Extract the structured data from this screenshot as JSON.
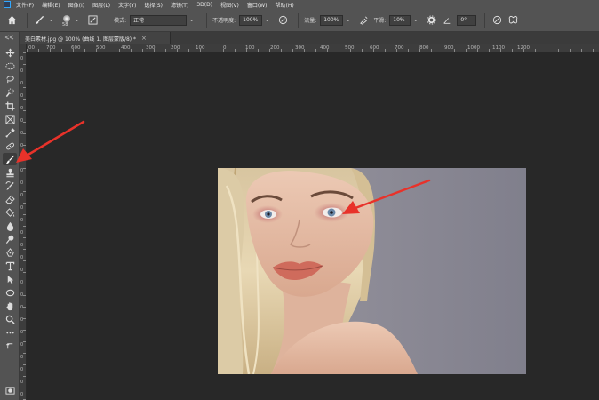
{
  "menubar": {
    "items": [
      "文件(F)",
      "编辑(E)",
      "图像(I)",
      "图层(L)",
      "文字(Y)",
      "选择(S)",
      "滤镜(T)",
      "3D(D)",
      "视图(V)",
      "窗口(W)",
      "帮助(H)"
    ]
  },
  "options": {
    "brush_size": "58",
    "mode_label": "模式:",
    "mode_value": "正常",
    "opacity_label": "不透明度:",
    "opacity_value": "100%",
    "flow_label": "流量:",
    "flow_value": "100%",
    "smoothing_label": "平滑:",
    "smoothing_value": "10%",
    "angle_value": "0°"
  },
  "document": {
    "tab_title": "美白素材.jpg @ 100% (曲线 1, 图层蒙版/8) *",
    "close_glyph": "×"
  },
  "ruler": {
    "h_labels": [
      "00",
      "700",
      "600",
      "500",
      "400",
      "300",
      "200",
      "100",
      "0",
      "100",
      "200",
      "300",
      "400",
      "500",
      "600",
      "700",
      "800",
      "900",
      "1000",
      "1100",
      "1200"
    ],
    "v_labels": [
      "0",
      "0",
      "0",
      "0",
      "0",
      "0",
      "0",
      "0",
      "0",
      "0",
      "0",
      "0",
      "0",
      "0",
      "0",
      "0",
      "0",
      "0",
      "0",
      "0",
      "0",
      "0",
      "0",
      "0",
      "0",
      "0",
      "0",
      "0",
      "0"
    ]
  },
  "toolbar": {
    "tools": [
      "move",
      "marquee",
      "lasso",
      "quick-select",
      "crop",
      "frame",
      "eyedropper",
      "healing",
      "brush",
      "stamp",
      "history-brush",
      "eraser",
      "gradient",
      "blur",
      "dodge",
      "pen",
      "type",
      "path-select",
      "shape",
      "hand",
      "zoom",
      "more"
    ],
    "active_tool": "brush",
    "fg_color": "#000000",
    "bg_color": "#ffffff"
  },
  "colors": {
    "ui_panel": "#535353",
    "canvas_bg": "#282828",
    "arrow": "#e8322a",
    "photo_bg": "#8a8a96"
  }
}
